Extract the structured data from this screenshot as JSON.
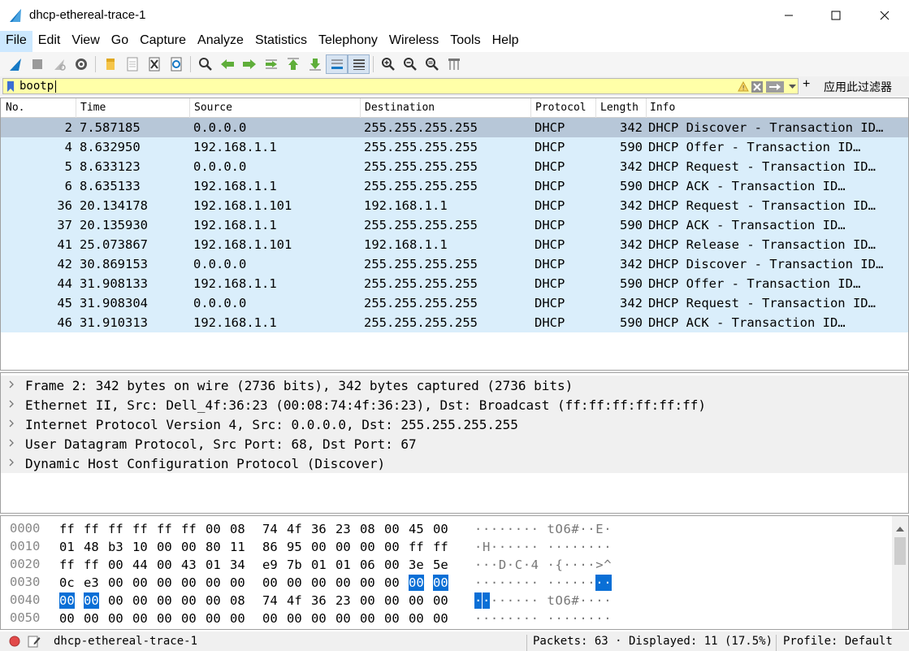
{
  "window": {
    "title": "dhcp-ethereal-trace-1",
    "minimize": "—",
    "maximize": "☐",
    "close": "✕"
  },
  "menu": [
    "File",
    "Edit",
    "View",
    "Go",
    "Capture",
    "Analyze",
    "Statistics",
    "Telephony",
    "Wireless",
    "Tools",
    "Help"
  ],
  "filter": {
    "value": "bootp",
    "apply_label": "应用此过滤器",
    "plus": "+"
  },
  "columns": [
    "No.",
    "Time",
    "Source",
    "Destination",
    "Protocol",
    "Length",
    "Info"
  ],
  "packets": [
    {
      "no": "2",
      "time": "7.587185",
      "src": "0.0.0.0",
      "dst": "255.255.255.255",
      "proto": "DHCP",
      "len": "342",
      "info": "DHCP Discover - Transaction ID…"
    },
    {
      "no": "4",
      "time": "8.632950",
      "src": "192.168.1.1",
      "dst": "255.255.255.255",
      "proto": "DHCP",
      "len": "590",
      "info": "DHCP Offer    - Transaction ID…"
    },
    {
      "no": "5",
      "time": "8.633123",
      "src": "0.0.0.0",
      "dst": "255.255.255.255",
      "proto": "DHCP",
      "len": "342",
      "info": "DHCP Request  - Transaction ID…"
    },
    {
      "no": "6",
      "time": "8.635133",
      "src": "192.168.1.1",
      "dst": "255.255.255.255",
      "proto": "DHCP",
      "len": "590",
      "info": "DHCP ACK      - Transaction ID…"
    },
    {
      "no": "36",
      "time": "20.134178",
      "src": "192.168.1.101",
      "dst": "192.168.1.1",
      "proto": "DHCP",
      "len": "342",
      "info": "DHCP Request  - Transaction ID…"
    },
    {
      "no": "37",
      "time": "20.135930",
      "src": "192.168.1.1",
      "dst": "255.255.255.255",
      "proto": "DHCP",
      "len": "590",
      "info": "DHCP ACK      - Transaction ID…"
    },
    {
      "no": "41",
      "time": "25.073867",
      "src": "192.168.1.101",
      "dst": "192.168.1.1",
      "proto": "DHCP",
      "len": "342",
      "info": "DHCP Release  - Transaction ID…"
    },
    {
      "no": "42",
      "time": "30.869153",
      "src": "0.0.0.0",
      "dst": "255.255.255.255",
      "proto": "DHCP",
      "len": "342",
      "info": "DHCP Discover - Transaction ID…"
    },
    {
      "no": "44",
      "time": "31.908133",
      "src": "192.168.1.1",
      "dst": "255.255.255.255",
      "proto": "DHCP",
      "len": "590",
      "info": "DHCP Offer    - Transaction ID…"
    },
    {
      "no": "45",
      "time": "31.908304",
      "src": "0.0.0.0",
      "dst": "255.255.255.255",
      "proto": "DHCP",
      "len": "342",
      "info": "DHCP Request  - Transaction ID…"
    },
    {
      "no": "46",
      "time": "31.910313",
      "src": "192.168.1.1",
      "dst": "255.255.255.255",
      "proto": "DHCP",
      "len": "590",
      "info": "DHCP ACK      - Transaction ID…"
    }
  ],
  "details": [
    "Frame 2: 342 bytes on wire (2736 bits), 342 bytes captured (2736 bits)",
    "Ethernet II, Src: Dell_4f:36:23 (00:08:74:4f:36:23), Dst: Broadcast (ff:ff:ff:ff:ff:ff)",
    "Internet Protocol Version 4, Src: 0.0.0.0, Dst: 255.255.255.255",
    "User Datagram Protocol, Src Port: 68, Dst Port: 67",
    "Dynamic Host Configuration Protocol (Discover)"
  ],
  "bytes": [
    {
      "off": "0000",
      "hex": [
        "ff",
        "ff",
        "ff",
        "ff",
        "ff",
        "ff",
        "00",
        "08",
        "74",
        "4f",
        "36",
        "23",
        "08",
        "00",
        "45",
        "00"
      ],
      "asc": [
        "·",
        "·",
        "·",
        "·",
        "·",
        "·",
        "·",
        "·",
        "t",
        "O",
        "6",
        "#",
        "·",
        "·",
        "E",
        "·"
      ],
      "hl": []
    },
    {
      "off": "0010",
      "hex": [
        "01",
        "48",
        "b3",
        "10",
        "00",
        "00",
        "80",
        "11",
        "86",
        "95",
        "00",
        "00",
        "00",
        "00",
        "ff",
        "ff"
      ],
      "asc": [
        "·",
        "H",
        "·",
        "·",
        "·",
        "·",
        "·",
        "·",
        "·",
        "·",
        "·",
        "·",
        "·",
        "·",
        "·",
        "·"
      ],
      "hl": []
    },
    {
      "off": "0020",
      "hex": [
        "ff",
        "ff",
        "00",
        "44",
        "00",
        "43",
        "01",
        "34",
        "e9",
        "7b",
        "01",
        "01",
        "06",
        "00",
        "3e",
        "5e"
      ],
      "asc": [
        "·",
        "·",
        "·",
        "D",
        "·",
        "C",
        "·",
        "4",
        "·",
        "{",
        "·",
        "·",
        "·",
        "·",
        ">",
        "^"
      ],
      "hl": []
    },
    {
      "off": "0030",
      "hex": [
        "0c",
        "e3",
        "00",
        "00",
        "00",
        "00",
        "00",
        "00",
        "00",
        "00",
        "00",
        "00",
        "00",
        "00",
        "00",
        "00"
      ],
      "asc": [
        "·",
        "·",
        "·",
        "·",
        "·",
        "·",
        "·",
        "·",
        "·",
        "·",
        "·",
        "·",
        "·",
        "·",
        "·",
        "·"
      ],
      "hl": [
        14,
        15
      ]
    },
    {
      "off": "0040",
      "hex": [
        "00",
        "00",
        "00",
        "00",
        "00",
        "00",
        "00",
        "08",
        "74",
        "4f",
        "36",
        "23",
        "00",
        "00",
        "00",
        "00"
      ],
      "asc": [
        "·",
        "·",
        "·",
        "·",
        "·",
        "·",
        "·",
        "·",
        "t",
        "O",
        "6",
        "#",
        "·",
        "·",
        "·",
        "·"
      ],
      "hl": [
        0,
        1
      ]
    },
    {
      "off": "0050",
      "hex": [
        "00",
        "00",
        "00",
        "00",
        "00",
        "00",
        "00",
        "00",
        "00",
        "00",
        "00",
        "00",
        "00",
        "00",
        "00",
        "00"
      ],
      "asc": [
        "·",
        "·",
        "·",
        "·",
        "·",
        "·",
        "·",
        "·",
        "·",
        "·",
        "·",
        "·",
        "·",
        "·",
        "·",
        "·"
      ],
      "hl": []
    }
  ],
  "status": {
    "file": "dhcp-ethereal-trace-1",
    "packets": "Packets: 63 · Displayed: 11 (17.5%)",
    "profile": "Profile: Default"
  },
  "colors": {
    "accent": "#0a6fd6",
    "row": "#daeefb",
    "selected_row": "#b7c7d8",
    "filter_bg": "#ffffa8"
  }
}
